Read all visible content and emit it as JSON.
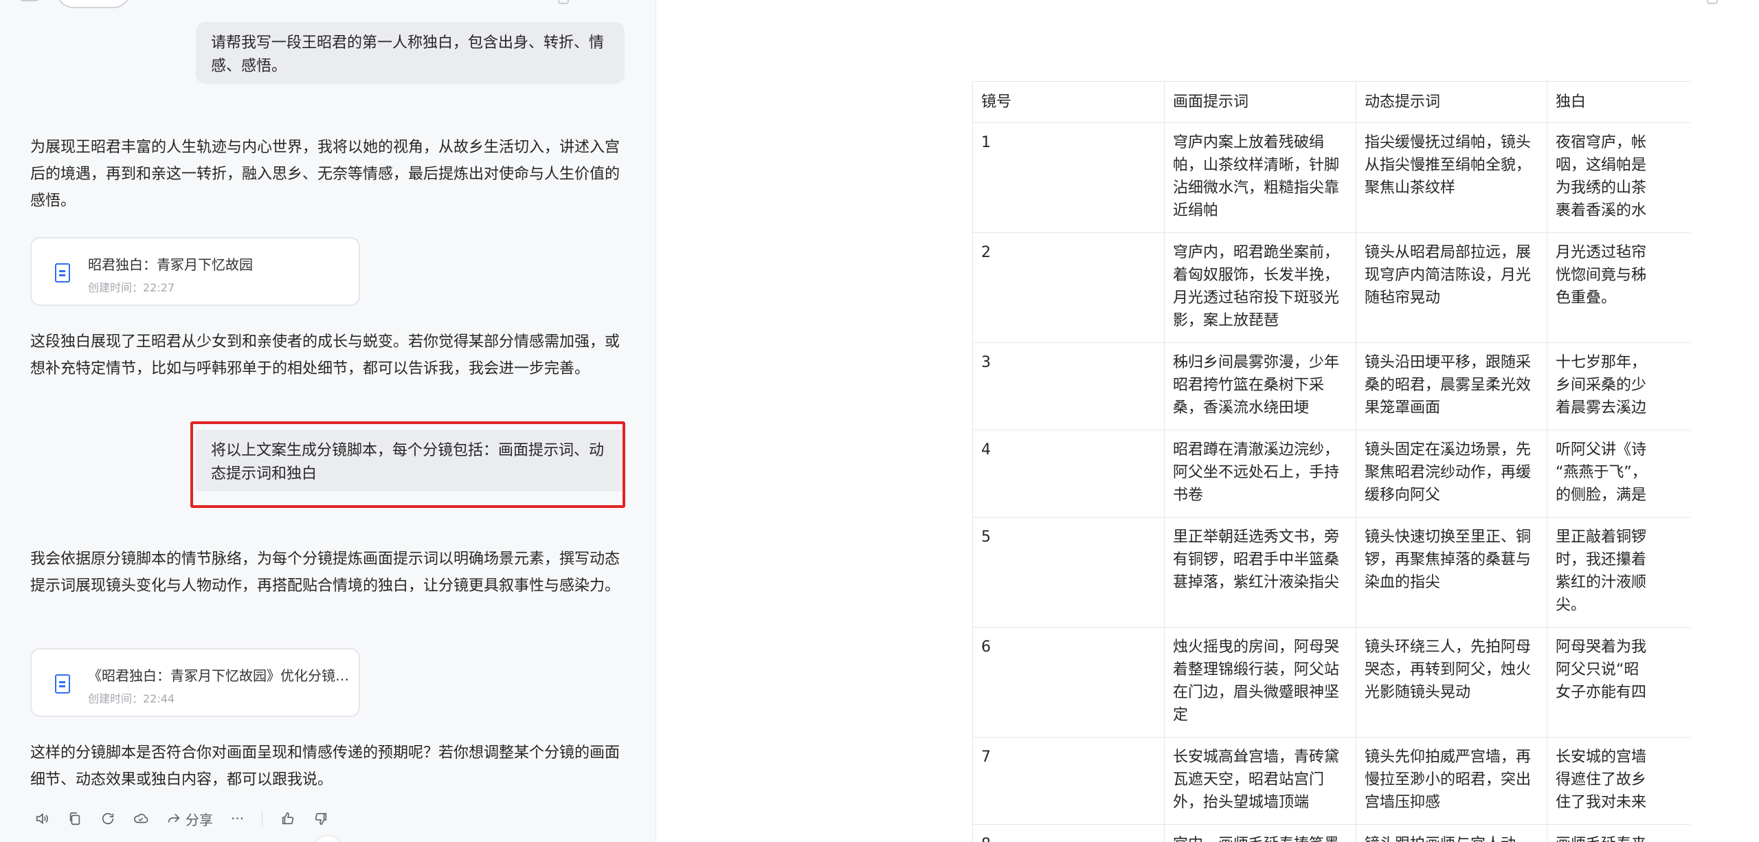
{
  "chat": {
    "user_messages": [
      "请帮我写一段王昭君的第一人称独白，包含出身、转折、情感、感悟。",
      "将以上文案生成分镜脚本，每个分镜包括：画面提示词、动态提示词和独白"
    ],
    "ai_paragraphs": [
      "为展现王昭君丰富的人生轨迹与内心世界，我将以她的视角，从故乡生活切入，讲述入宫后的境遇，再到和亲这一转折，融入思乡、无奈等情感，最后提炼出对使命与人生价值的感悟。",
      "这段独白展现了王昭君从少女到和亲使者的成长与蜕变。若你觉得某部分情感需加强，或想补充特定情节，比如与呼韩邪单于的相处细节，都可以告诉我，我会进一步完善。",
      "我会依据原分镜脚本的情节脉络，为每个分镜提炼画面提示词以明确场景元素，撰写动态提示词展现镜头变化与人物动作，再搭配贴合情境的独白，让分镜更具叙事性与感染力。",
      "这样的分镜脚本是否符合你对画面呈现和情感传递的预期呢？若你想调整某个分镜的画面细节、动态效果或独白内容，都可以跟我说。"
    ],
    "doc_cards": [
      {
        "title": "昭君独白：青冢月下忆故园",
        "time": "创建时间：22:27",
        "icon": "document-icon"
      },
      {
        "title": "《昭君独白：青冢月下忆故园》优化分镜脚本",
        "time": "创建时间：22:44",
        "icon": "document-icon"
      }
    ],
    "actions": {
      "share_label": "分享",
      "more_label": "···"
    }
  },
  "storyboard": {
    "headers": [
      "镜号",
      "画面提示词",
      "动态提示词",
      "独白"
    ],
    "rows": [
      [
        "1",
        "穹庐内案上放着残破绢帕，山茶纹样清晰，针脚沾细微水汽，粗糙指尖靠近绢帕",
        "指尖缓慢抚过绢帕，镜头从指尖慢推至绢帕全貌，聚焦山茶纹样",
        "夜宿穹庐，帐\n咽，这绢帕是\n为我绣的山茶\n裹着香溪的水"
      ],
      [
        "2",
        "穹庐内，昭君跪坐案前，着匈奴服饰，长发半挽，月光透过毡帘投下斑驳光影，案上放琵琶",
        "镜头从昭君局部拉远，展现穹庐内简洁陈设，月光随毡帘晃动",
        "月光透过毡帘\n恍惚间竟与秭\n色重叠。"
      ],
      [
        "3",
        "秭归乡间晨雾弥漫，少年昭君挎竹篮在桑树下采桑，香溪流水绕田埂",
        "镜头沿田埂平移，跟随采桑的昭君，晨雾呈柔光效果笼罩画面",
        "十七岁那年，\n乡间采桑的少\n着晨雾去溪边"
      ],
      [
        "4",
        "昭君蹲在清澈溪边浣纱，阿父坐不远处石上，手持书卷",
        "镜头固定在溪边场景，先聚焦昭君浣纱动作，再缓缓移向阿父",
        "听阿父讲《诗\n“燕燕于飞”，\n的侧脸，满是"
      ],
      [
        "5",
        "里正举朝廷选秀文书，旁有铜锣，昭君手中半篮桑葚掉落，紫红汁液染指尖",
        "镜头快速切换至里正、铜锣，再聚焦掉落的桑葚与染血的指尖",
        "里正敲着铜锣\n时，我还攥着\n紫红的汁液顺\n尖。"
      ],
      [
        "6",
        "烛火摇曳的房间，阿母哭着整理锦缎行装，阿父站在门边，眉头微蹙眼神坚定",
        "镜头环绕三人，先拍阿母哭态，再转到阿父，烛火光影随镜头晃动",
        "阿母哭着为我\n阿父只说“昭\n女子亦能有四"
      ],
      [
        "7",
        "长安城高耸宫墙，青砖黛瓦遮天空，昭君站宫门外，抬头望城墙顶端",
        "镜头先仰拍威严宫墙，再慢拉至渺小的昭君，突出宫墙压抑感",
        "长安城的宫墙\n得遮住了故乡\n住了我对未来"
      ],
      [
        "8",
        "宫内，画师毛延寿捧笔墨",
        "镜头跟拍画师与宫人动",
        "画师毛延寿来"
      ]
    ]
  },
  "colors": {
    "panel_bg": "#f7f8fa",
    "user_bubble": "#ebecef",
    "highlight": "#e02424",
    "accent": "#2f6df2",
    "border": "#e4e6ea"
  },
  "icons": [
    "speaker-icon",
    "copy-icon",
    "refresh-icon",
    "check-cloud-icon",
    "share-icon",
    "more-icon",
    "thumbs-up-icon",
    "thumbs-down-icon",
    "document-icon"
  ]
}
